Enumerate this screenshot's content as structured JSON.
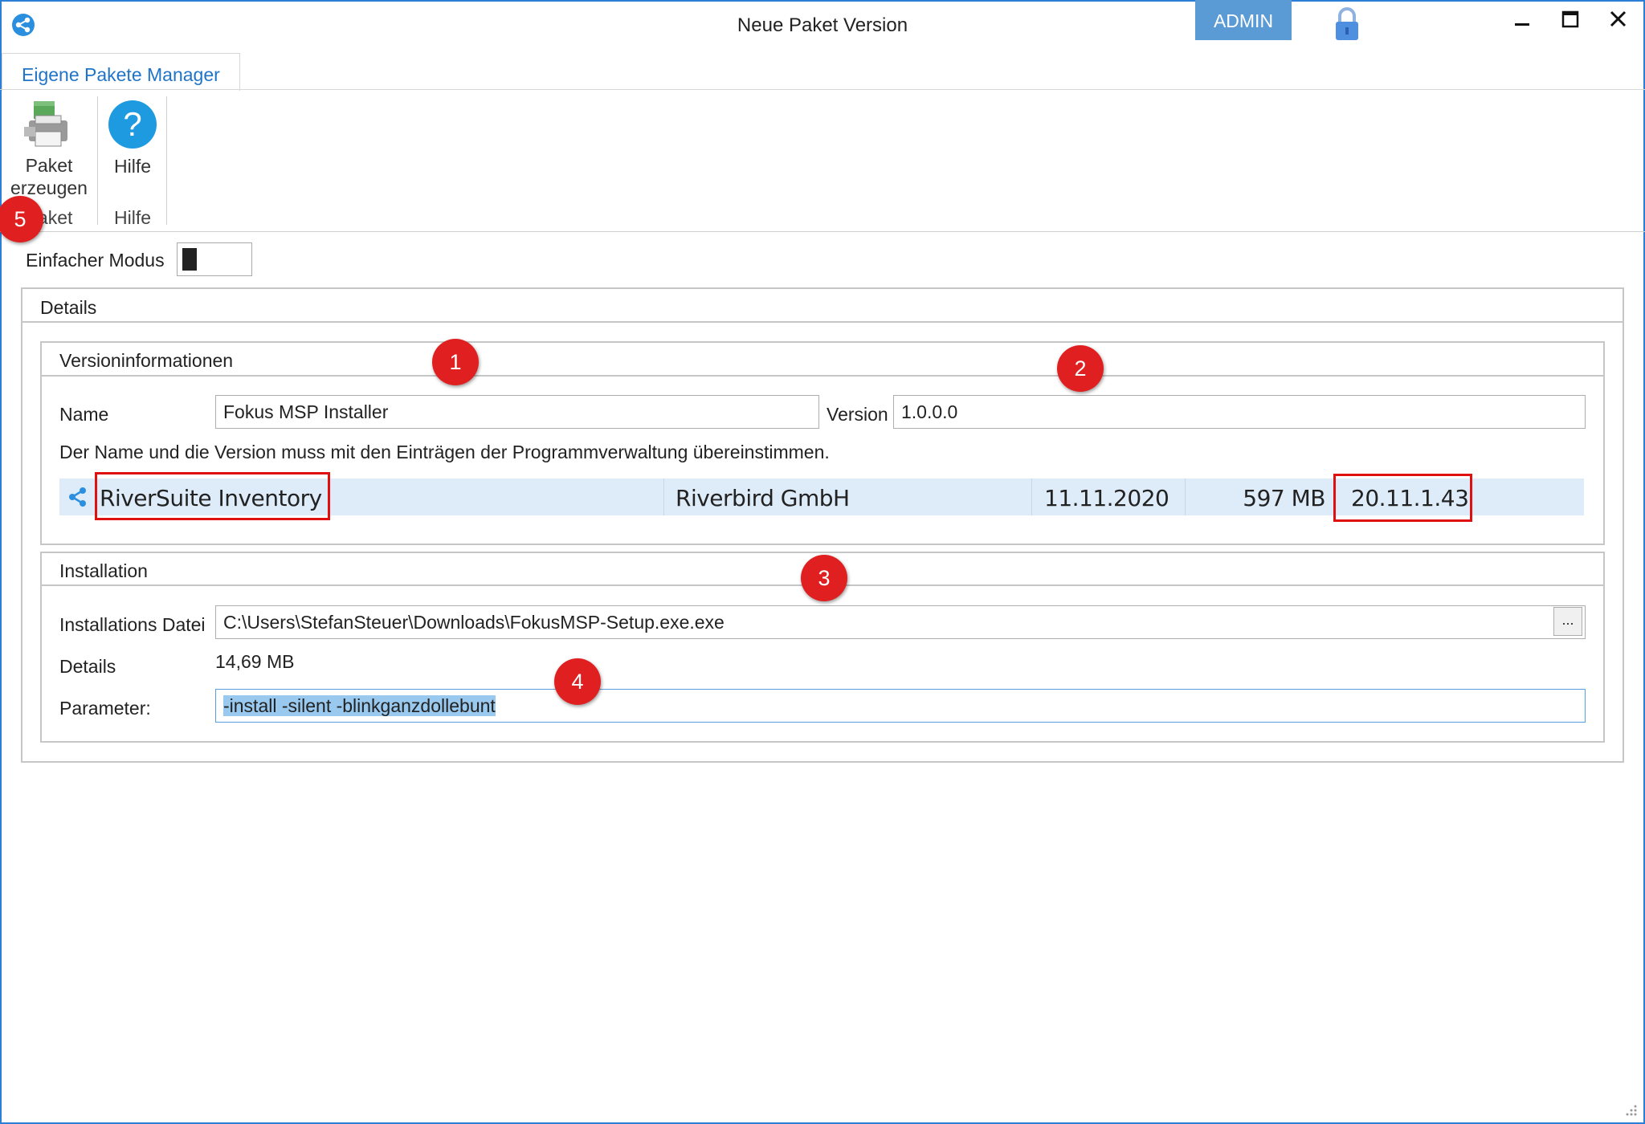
{
  "window": {
    "title": "Neue Paket Version",
    "badge": "ADMIN"
  },
  "tabs": [
    {
      "label": "Eigene Pakete Manager"
    }
  ],
  "ribbon": {
    "create_line1": "Paket",
    "create_line2": "erzeugen",
    "create_group": "Paket",
    "help_label": "Hilfe",
    "help_group": "Hilfe",
    "help_glyph": "?"
  },
  "simple_mode_label": "Einfacher Modus",
  "details_title": "Details",
  "version_info": {
    "title": "Versioninformationen",
    "name_label": "Name",
    "name_value": "Fokus MSP Installer",
    "version_label": "Version",
    "version_value": "1.0.0.0",
    "hint": "Der Name und die Version muss mit den Einträgen der Programmverwaltung übereinstimmen.",
    "row": {
      "name": "RiverSuite Inventory",
      "publisher": "Riverbird GmbH",
      "date": "11.11.2020",
      "size": "597 MB",
      "version": "20.11.1.43"
    }
  },
  "installation": {
    "title": "Installation",
    "file_label": "Installations Datei",
    "file_value": "C:\\Users\\StefanSteuer\\Downloads\\FokusMSP-Setup.exe.exe",
    "browse_label": "...",
    "details_label": "Details",
    "details_value": "14,69 MB",
    "param_label": "Parameter:",
    "param_value": "-install -silent -blinkganzdollebunt"
  },
  "markers": [
    "1",
    "2",
    "3",
    "4",
    "5"
  ],
  "colors": {
    "accent": "#2b7fd6",
    "marker": "#e02020",
    "highlight": "#e01010",
    "row_selected": "#deecf9"
  },
  "icons": [
    "share-icon",
    "lock-icon",
    "minimize-icon",
    "maximize-icon",
    "close-icon",
    "package-icon",
    "help-icon"
  ]
}
